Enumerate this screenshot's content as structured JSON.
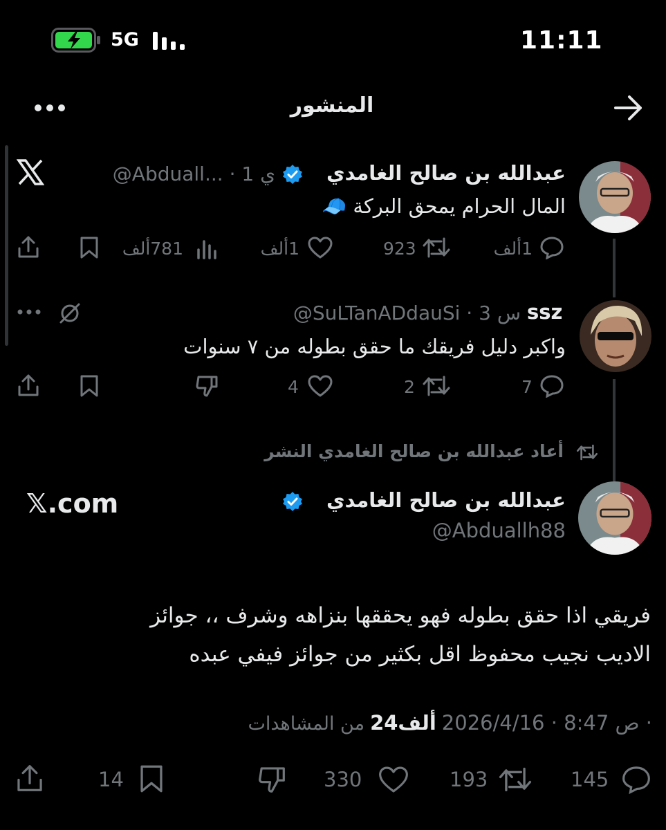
{
  "status_bar": {
    "network": "5G",
    "time": "11:11"
  },
  "header": {
    "title": "المنشور",
    "back_icon": "arrow-right-icon",
    "more_icon": "more-horizontal-icon"
  },
  "tweet1": {
    "name": "عبدالله بن صالح الغامدي",
    "meta": "@Abduall... · 1 ي",
    "text": "المال الحرام يمحق البركة 🧢",
    "replies": "1ألف",
    "retweets": "923",
    "likes": "1ألف",
    "views": "781ألف",
    "source_icon": "x-logo-icon"
  },
  "tweet2": {
    "name": "ssz",
    "meta": "@SuLTanADdauSi · 3 س",
    "text": "واكبر دليل فريقك ما حقق بطوله من ٧ سنوات",
    "replies": "7",
    "retweets": "2",
    "likes": "4"
  },
  "repost_banner": {
    "text": "أعاد عبدالله بن صالح الغامدي النشر"
  },
  "main_tweet": {
    "name": "عبدالله بن صالح الغامدي",
    "handle": "@Abduallh88",
    "watermark": "𝕏.com",
    "text_line1": "فريقي اذا حقق بطوله فهو يحققها بنزاهه وشرف ،، جوائز",
    "text_line2": "الاديب نجيب محفوظ اقل بكثير من جوائز فيفي عبده",
    "date_time": "2026/4/16 · 8:47 ص ·",
    "views_count": "24ألف",
    "views_label": "من المشاهدات",
    "replies": "145",
    "retweets": "193",
    "likes": "330",
    "bookmarks": "14"
  },
  "colors": {
    "background": "#000000",
    "text": "#e7e9ea",
    "muted": "#71767b",
    "verified": "#1d9bf0",
    "battery": "#32d74b"
  }
}
